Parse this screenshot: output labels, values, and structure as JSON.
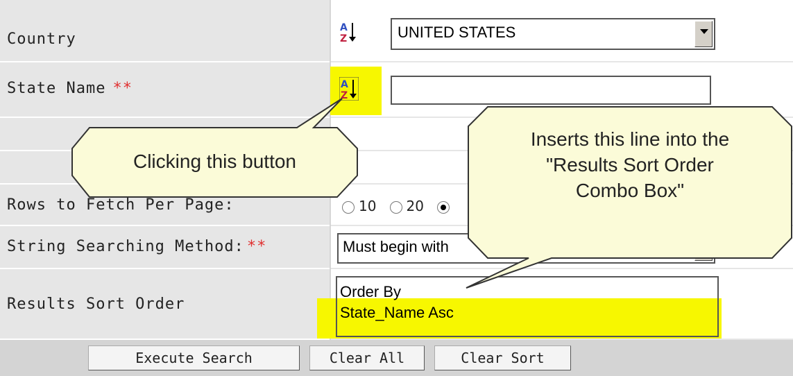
{
  "form": {
    "rows": [
      {
        "label": "Country"
      },
      {
        "label": "State Name",
        "required": "**"
      },
      {
        "label": ""
      },
      {
        "label": ""
      },
      {
        "label": "Rows to Fetch Per Page:"
      },
      {
        "label": "String Searching Method:",
        "required": "**"
      },
      {
        "label": "Results Sort Order"
      }
    ],
    "country_value": "UNITED STATES",
    "state_name_value": "",
    "rows_options": [
      "10",
      "20"
    ],
    "rows_selected": "",
    "string_method_value": "Must begin with",
    "sort_order_lines": [
      "Order By",
      "State_Name Asc"
    ]
  },
  "buttons": {
    "execute": "Execute Search",
    "clear_all": "Clear All",
    "clear_sort": "Clear Sort"
  },
  "callouts": {
    "left": "Clicking this button",
    "right": [
      "Inserts this line into the",
      "\"Results Sort Order",
      "Combo Box\""
    ]
  },
  "colors": {
    "highlight": "#f7f700",
    "callout_fill": "#fbfbd8",
    "required": "#e03030"
  },
  "icons": {
    "sort": "sort-az-icon"
  }
}
